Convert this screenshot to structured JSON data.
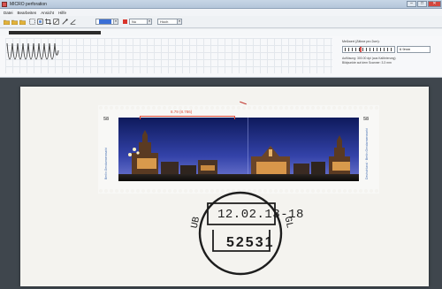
{
  "window": {
    "title": "MICRO perforation",
    "controls": {
      "minimize": "–",
      "maximize": "□",
      "close": "✕"
    }
  },
  "menu": [
    "Datei",
    "Bearbeiten",
    "Ansicht",
    "Hilfe"
  ],
  "toolbar": {
    "icons": [
      "open-icon",
      "save-icon",
      "print-icon",
      "select-icon",
      "frame-icon",
      "crop-icon",
      "zoom-icon",
      "measure-icon",
      "angle-icon"
    ],
    "color_select": "",
    "perforation_select": "Nu",
    "resolution_select": "Hoch",
    "accent_colors": {
      "blue": "#3a6fd6",
      "red": "#d9342b",
      "measure": "#e04e39"
    }
  },
  "info": {
    "label": "Meßwert (Zähne pro 2cm):",
    "gauge_position": 0.33,
    "value": "6 9mm",
    "note_line1": "Auflösung: 300.00 dpi (aus Kalibrierung)",
    "note_line2": "Bildpunkte auf dem Scanner: 3.3 mm"
  },
  "measurement": {
    "label": "8.79 (8.786)"
  },
  "stamp": {
    "value_left": "58",
    "value_right": "58",
    "side_text_left": "Berlin Gendarmenmarkt",
    "side_text_right": "Deutschland · Berlin Gendarmenmarkt"
  },
  "postmark": {
    "date": "12.02.13-18",
    "zip": "52531",
    "left_letters": "UB",
    "right_letters": "GL"
  }
}
